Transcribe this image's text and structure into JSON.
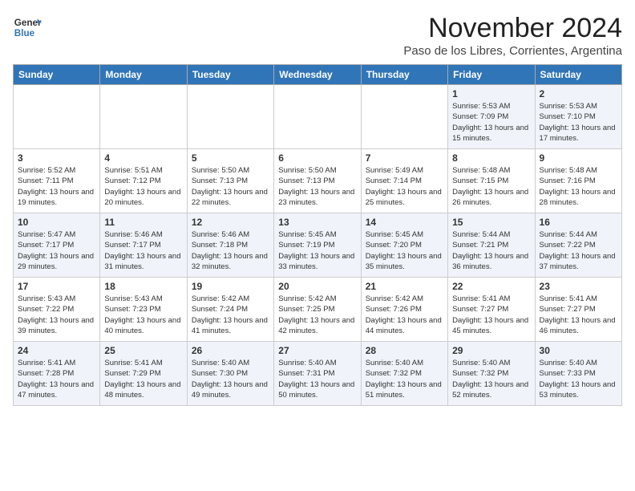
{
  "header": {
    "logo_line1": "General",
    "logo_line2": "Blue",
    "month": "November 2024",
    "location": "Paso de los Libres, Corrientes, Argentina"
  },
  "weekdays": [
    "Sunday",
    "Monday",
    "Tuesday",
    "Wednesday",
    "Thursday",
    "Friday",
    "Saturday"
  ],
  "weeks": [
    [
      {
        "day": "",
        "info": ""
      },
      {
        "day": "",
        "info": ""
      },
      {
        "day": "",
        "info": ""
      },
      {
        "day": "",
        "info": ""
      },
      {
        "day": "",
        "info": ""
      },
      {
        "day": "1",
        "info": "Sunrise: 5:53 AM\nSunset: 7:09 PM\nDaylight: 13 hours and 15 minutes."
      },
      {
        "day": "2",
        "info": "Sunrise: 5:53 AM\nSunset: 7:10 PM\nDaylight: 13 hours and 17 minutes."
      }
    ],
    [
      {
        "day": "3",
        "info": "Sunrise: 5:52 AM\nSunset: 7:11 PM\nDaylight: 13 hours and 19 minutes."
      },
      {
        "day": "4",
        "info": "Sunrise: 5:51 AM\nSunset: 7:12 PM\nDaylight: 13 hours and 20 minutes."
      },
      {
        "day": "5",
        "info": "Sunrise: 5:50 AM\nSunset: 7:13 PM\nDaylight: 13 hours and 22 minutes."
      },
      {
        "day": "6",
        "info": "Sunrise: 5:50 AM\nSunset: 7:13 PM\nDaylight: 13 hours and 23 minutes."
      },
      {
        "day": "7",
        "info": "Sunrise: 5:49 AM\nSunset: 7:14 PM\nDaylight: 13 hours and 25 minutes."
      },
      {
        "day": "8",
        "info": "Sunrise: 5:48 AM\nSunset: 7:15 PM\nDaylight: 13 hours and 26 minutes."
      },
      {
        "day": "9",
        "info": "Sunrise: 5:48 AM\nSunset: 7:16 PM\nDaylight: 13 hours and 28 minutes."
      }
    ],
    [
      {
        "day": "10",
        "info": "Sunrise: 5:47 AM\nSunset: 7:17 PM\nDaylight: 13 hours and 29 minutes."
      },
      {
        "day": "11",
        "info": "Sunrise: 5:46 AM\nSunset: 7:17 PM\nDaylight: 13 hours and 31 minutes."
      },
      {
        "day": "12",
        "info": "Sunrise: 5:46 AM\nSunset: 7:18 PM\nDaylight: 13 hours and 32 minutes."
      },
      {
        "day": "13",
        "info": "Sunrise: 5:45 AM\nSunset: 7:19 PM\nDaylight: 13 hours and 33 minutes."
      },
      {
        "day": "14",
        "info": "Sunrise: 5:45 AM\nSunset: 7:20 PM\nDaylight: 13 hours and 35 minutes."
      },
      {
        "day": "15",
        "info": "Sunrise: 5:44 AM\nSunset: 7:21 PM\nDaylight: 13 hours and 36 minutes."
      },
      {
        "day": "16",
        "info": "Sunrise: 5:44 AM\nSunset: 7:22 PM\nDaylight: 13 hours and 37 minutes."
      }
    ],
    [
      {
        "day": "17",
        "info": "Sunrise: 5:43 AM\nSunset: 7:22 PM\nDaylight: 13 hours and 39 minutes."
      },
      {
        "day": "18",
        "info": "Sunrise: 5:43 AM\nSunset: 7:23 PM\nDaylight: 13 hours and 40 minutes."
      },
      {
        "day": "19",
        "info": "Sunrise: 5:42 AM\nSunset: 7:24 PM\nDaylight: 13 hours and 41 minutes."
      },
      {
        "day": "20",
        "info": "Sunrise: 5:42 AM\nSunset: 7:25 PM\nDaylight: 13 hours and 42 minutes."
      },
      {
        "day": "21",
        "info": "Sunrise: 5:42 AM\nSunset: 7:26 PM\nDaylight: 13 hours and 44 minutes."
      },
      {
        "day": "22",
        "info": "Sunrise: 5:41 AM\nSunset: 7:27 PM\nDaylight: 13 hours and 45 minutes."
      },
      {
        "day": "23",
        "info": "Sunrise: 5:41 AM\nSunset: 7:27 PM\nDaylight: 13 hours and 46 minutes."
      }
    ],
    [
      {
        "day": "24",
        "info": "Sunrise: 5:41 AM\nSunset: 7:28 PM\nDaylight: 13 hours and 47 minutes."
      },
      {
        "day": "25",
        "info": "Sunrise: 5:41 AM\nSunset: 7:29 PM\nDaylight: 13 hours and 48 minutes."
      },
      {
        "day": "26",
        "info": "Sunrise: 5:40 AM\nSunset: 7:30 PM\nDaylight: 13 hours and 49 minutes."
      },
      {
        "day": "27",
        "info": "Sunrise: 5:40 AM\nSunset: 7:31 PM\nDaylight: 13 hours and 50 minutes."
      },
      {
        "day": "28",
        "info": "Sunrise: 5:40 AM\nSunset: 7:32 PM\nDaylight: 13 hours and 51 minutes."
      },
      {
        "day": "29",
        "info": "Sunrise: 5:40 AM\nSunset: 7:32 PM\nDaylight: 13 hours and 52 minutes."
      },
      {
        "day": "30",
        "info": "Sunrise: 5:40 AM\nSunset: 7:33 PM\nDaylight: 13 hours and 53 minutes."
      }
    ]
  ]
}
